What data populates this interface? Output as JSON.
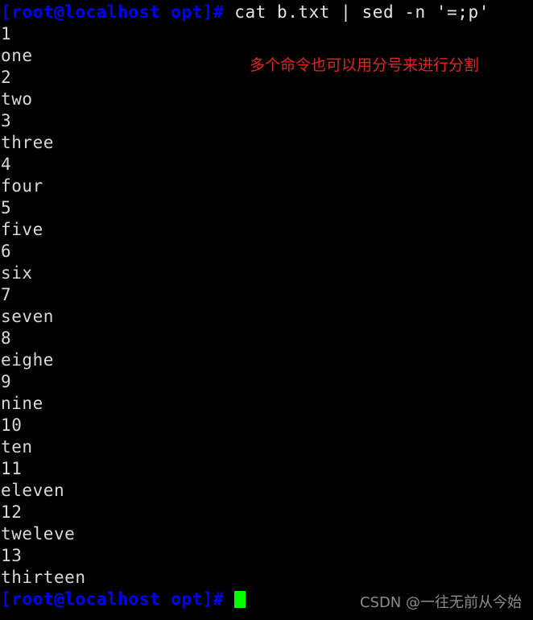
{
  "terminal": {
    "background_color": "#000000",
    "foreground_color": "#d8d8d8",
    "prompt_color": "#0000ff",
    "cursor_color": "#00ff00",
    "prompt_text": "[root@localhost opt]# ",
    "command": "cat b.txt | sed -n '=;p'",
    "output_lines": [
      "1",
      "one",
      "2",
      "two",
      "3",
      "three",
      "4",
      "four",
      "5",
      "five",
      "6",
      "six",
      "7",
      "seven",
      "8",
      "eighe",
      "9",
      "nine",
      "10",
      "ten",
      "11",
      "eleven",
      "12",
      "tweleve",
      "13",
      "thirteen"
    ],
    "final_prompt_text": "[root@localhost opt]# "
  },
  "annotation": {
    "text": "多个命令也可以用分号来进行分割",
    "color": "#e42222"
  },
  "watermark": {
    "text": "CSDN @一往无前从今始",
    "color": "#8d8d8d"
  }
}
